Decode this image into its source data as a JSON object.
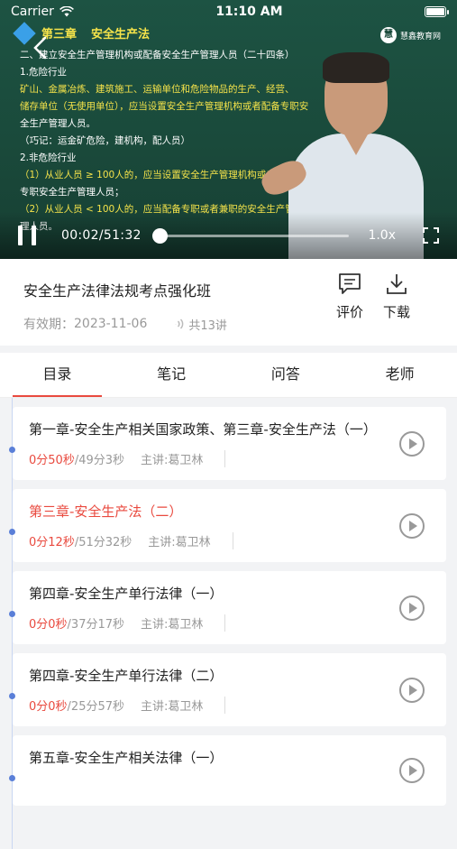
{
  "status_bar": {
    "carrier": "Carrier",
    "time": "11:10 AM"
  },
  "video": {
    "chapter_label": "第三章",
    "chapter_name": "安全生产法",
    "school_logo_text": "慧鑫教育网",
    "board_lines": [
      {
        "text": "二、建立安全生产管理机构或配备安全生产管理人员（二十四条）",
        "style": ""
      },
      {
        "text": "1.危险行业",
        "style": ""
      },
      {
        "text": "矿山、金属冶炼、建筑施工、运输单位和危险物品的生产、经营、",
        "style": "y"
      },
      {
        "text": "储存单位（无使用单位），应当设置安全生产管理机构或者配备专职安",
        "style": "y"
      },
      {
        "text": "全生产管理人员。",
        "style": ""
      },
      {
        "text": "（巧记：运金矿危险，建机构，配人员）",
        "style": ""
      },
      {
        "text": "2.非危险行业",
        "style": ""
      },
      {
        "text": "（1）从业人员 ≥ 100人的，应当设置安全生产管理机构或者配备",
        "style": "y"
      },
      {
        "text": "专职安全生产管理人员；",
        "style": ""
      },
      {
        "text": "（2）从业人员 < 100人的，应当配备专职或者兼职的安全生产管",
        "style": "y"
      },
      {
        "text": "理人员。",
        "style": ""
      }
    ],
    "current_time": "00:02",
    "total_time": "51:32",
    "progress": 0.0006,
    "speed": "1.0x"
  },
  "course": {
    "title": "安全生产法律法规考点强化班",
    "validity_label": "有效期：",
    "validity_date": "2023-11-06",
    "lessons_count": "共13讲",
    "review_label": "评价",
    "download_label": "下载"
  },
  "tabs": [
    {
      "label": "目录",
      "active": true
    },
    {
      "label": "笔记",
      "active": false
    },
    {
      "label": "问答",
      "active": false
    },
    {
      "label": "老师",
      "active": false
    }
  ],
  "lessons": [
    {
      "title": "第一章-安全生产相关国家政策、第三章-安全生产法（一）",
      "watched": "0分50秒",
      "duration": "/49分3秒",
      "teacher": "主讲:葛卫林",
      "current": false
    },
    {
      "title": "第三章-安全生产法（二）",
      "watched": "0分12秒",
      "duration": "/51分32秒",
      "teacher": "主讲:葛卫林",
      "current": true
    },
    {
      "title": "第四章-安全生产单行法律（一）",
      "watched": "0分0秒",
      "duration": "/37分17秒",
      "teacher": "主讲:葛卫林",
      "current": false
    },
    {
      "title": "第四章-安全生产单行法律（二）",
      "watched": "0分0秒",
      "duration": "/25分57秒",
      "teacher": "主讲:葛卫林",
      "current": false
    },
    {
      "title": "第五章-安全生产相关法律（一）",
      "watched": "",
      "duration": "",
      "teacher": "",
      "current": false
    }
  ],
  "colors": {
    "accent": "#e94a3f",
    "timeline": "#5a7fd8",
    "board": "#1a4a3b",
    "board_highlight": "#f5e34a"
  }
}
